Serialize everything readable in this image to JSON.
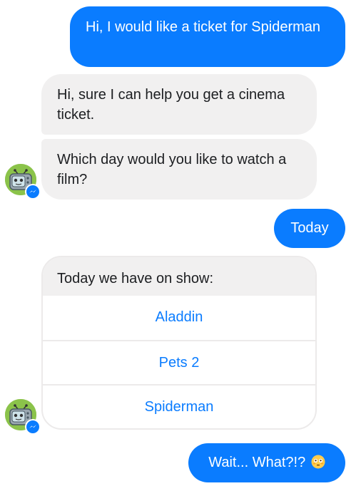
{
  "messages": {
    "user_1": "Hi, I would like a ticket for Spiderman",
    "bot_1": "Hi, sure I can help you get a cinema ticket.",
    "bot_2": "Which day would you like to watch a film?",
    "user_2": "Today",
    "user_3": "Wait... What?!?"
  },
  "card": {
    "header": "Today we have on show:",
    "options": [
      "Aladdin",
      "Pets 2",
      "Spiderman"
    ]
  },
  "icons": {
    "avatar": "robot-tv-avatar-icon",
    "badge": "messenger-icon",
    "emoji": "flushed-face-emoji-icon"
  },
  "colors": {
    "outgoing_bubble": "#0a7cff",
    "incoming_bubble": "#f1f0f0",
    "link": "#0a7cff",
    "avatar_bg": "#8bc34a"
  }
}
